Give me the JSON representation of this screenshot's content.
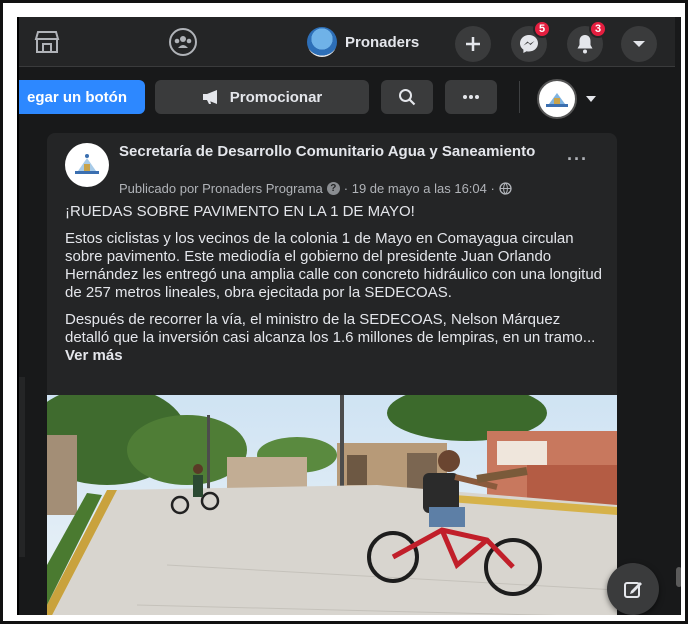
{
  "nav": {
    "page_name": "Pronaders",
    "messenger_badge": "5",
    "notifications_badge": "3"
  },
  "actions": {
    "add_button_label": "egar un botón",
    "promote_label": "Promocionar"
  },
  "post": {
    "author": "Secretaría de Desarrollo Comunitario Agua y Saneamiento",
    "meta": "Publicado por Pronaders Programa",
    "date": "· 19 de mayo a las 16:04 ·",
    "headline": "¡RUEDAS SOBRE PAVIMENTO EN LA 1 DE MAYO!",
    "paragraph1": "Estos ciclistas y los vecinos de la colonia 1 de Mayo en Comayagua circulan sobre pavimento. Este mediodía el gobierno del presidente Juan Orlando Hernández les entregó una amplia calle con concreto hidráulico con  una longitud de 257 metros lineales, obra ejecitada por la SEDECOAS.",
    "paragraph2": "Después de recorrer la vía, el ministro de la SEDECOAS, Nelson Márquez detalló que la  inversión casi alcanza los 1.6 millones de lempiras, en un tramo...",
    "see_more": "Ver más",
    "more_dots": "···"
  },
  "icons": {
    "store": "store-icon",
    "groups": "groups-icon",
    "plus": "plus-icon",
    "messenger": "messenger-icon",
    "bell": "bell-icon",
    "caret": "caret-down-icon",
    "megaphone": "megaphone-icon",
    "search": "search-icon",
    "compose": "compose-icon",
    "globe": "globe-icon"
  },
  "colors": {
    "accent": "#2d88ff",
    "background": "#18191a",
    "card": "#242526",
    "badge": "#e41e3f"
  }
}
